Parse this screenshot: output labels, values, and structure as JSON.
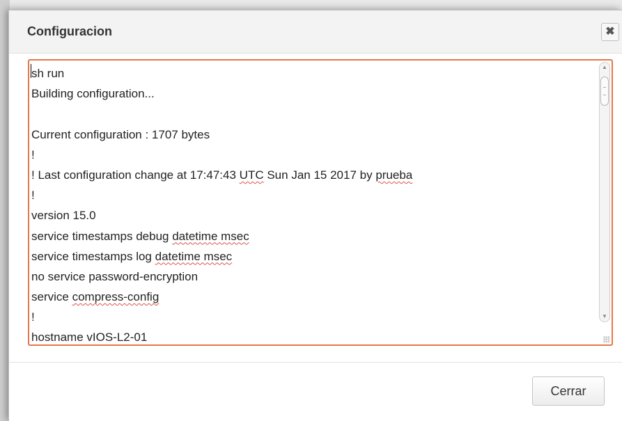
{
  "dialog": {
    "title": "Configuracion",
    "close_glyph": "✖",
    "close_icon": "close-icon",
    "footer": {
      "close_button_label": "Cerrar"
    },
    "accent_color": "#e8764a"
  },
  "config_output": {
    "lines": [
      {
        "segments": [
          {
            "text": "sh run"
          }
        ]
      },
      {
        "segments": [
          {
            "text": "Building configuration..."
          }
        ]
      },
      {
        "segments": [
          {
            "text": ""
          }
        ]
      },
      {
        "segments": [
          {
            "text": "Current configuration : 1707 bytes"
          }
        ]
      },
      {
        "segments": [
          {
            "text": "!"
          }
        ]
      },
      {
        "segments": [
          {
            "text": "! Last configuration change at 17:47:43 "
          },
          {
            "text": "UTC",
            "spell": true
          },
          {
            "text": " Sun Jan 15 2017 by "
          },
          {
            "text": "prueba",
            "spell": true
          }
        ]
      },
      {
        "segments": [
          {
            "text": "!"
          }
        ]
      },
      {
        "segments": [
          {
            "text": "version 15.0"
          }
        ]
      },
      {
        "segments": [
          {
            "text": "service timestamps debug "
          },
          {
            "text": "datetime msec",
            "spell": true
          }
        ]
      },
      {
        "segments": [
          {
            "text": "service timestamps log "
          },
          {
            "text": "datetime msec",
            "spell": true
          }
        ]
      },
      {
        "segments": [
          {
            "text": "no service password-encryption"
          }
        ]
      },
      {
        "segments": [
          {
            "text": "service "
          },
          {
            "text": "compress-config",
            "spell": true
          }
        ]
      },
      {
        "segments": [
          {
            "text": "!"
          }
        ]
      },
      {
        "segments": [
          {
            "text": "hostname vIOS-L2-01"
          }
        ]
      }
    ]
  }
}
